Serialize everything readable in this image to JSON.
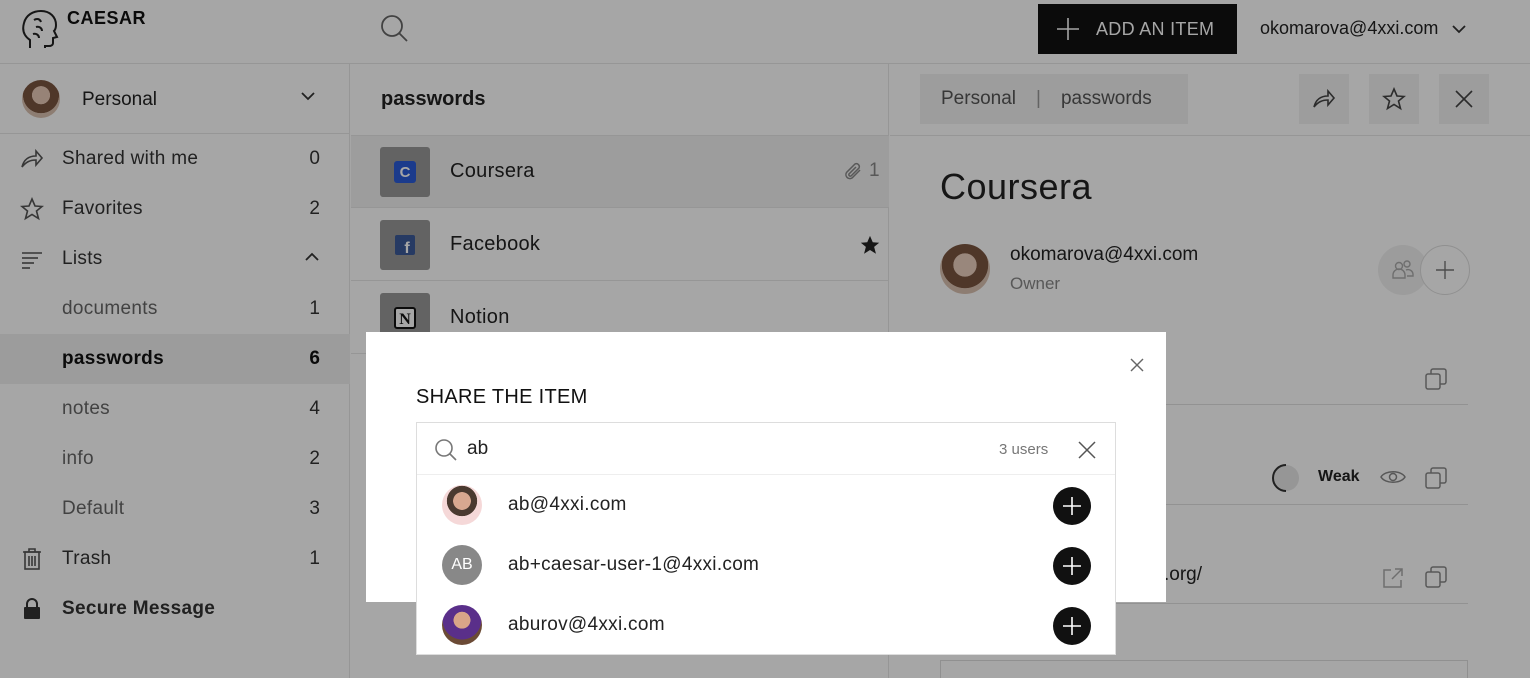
{
  "app": {
    "brand": "CAESAR"
  },
  "header": {
    "add_label": "ADD AN ITEM",
    "user_email": "okomarova@4xxi.com"
  },
  "sidebar": {
    "vault_name": "Personal",
    "items": [
      {
        "label": "Shared with me",
        "count": "0",
        "icon": "share-icon"
      },
      {
        "label": "Favorites",
        "count": "2",
        "icon": "star-icon"
      },
      {
        "label": "Lists",
        "count": "",
        "icon": "lists-icon"
      },
      {
        "label": "documents",
        "count": "1"
      },
      {
        "label": "passwords",
        "count": "6"
      },
      {
        "label": "notes",
        "count": "4"
      },
      {
        "label": "info",
        "count": "2"
      },
      {
        "label": "Default",
        "count": "3"
      },
      {
        "label": "Trash",
        "count": "1",
        "icon": "trash-icon"
      },
      {
        "label": "Secure Message",
        "count": "",
        "icon": "lock-icon"
      }
    ]
  },
  "list": {
    "title": "passwords",
    "items": [
      {
        "name": "Coursera",
        "attachments": "1",
        "icon_letter": "C"
      },
      {
        "name": "Facebook",
        "icon_letter": "f"
      },
      {
        "name": "Notion",
        "icon_letter": "N"
      }
    ]
  },
  "detail": {
    "breadcrumb": {
      "vault": "Personal",
      "separator": "|",
      "list": "passwords"
    },
    "title": "Coursera",
    "owner": {
      "email": "okomarova@4xxi.com",
      "role": "Owner"
    },
    "password_strength": "Weak",
    "url_fragment": ".org/"
  },
  "modal": {
    "title": "SHARE THE ITEM",
    "search_value": "ab",
    "result_count": "3 users",
    "users": [
      {
        "email": "ab@4xxi.com",
        "initials": ""
      },
      {
        "email": "ab+caesar-user-1@4xxi.com",
        "initials": "AB"
      },
      {
        "email": "aburov@4xxi.com",
        "initials": ""
      }
    ]
  },
  "colors": {
    "primary": "#111111",
    "overlay": "rgba(0,0,0,0.35)",
    "selected_bg": "#f0f0f0"
  }
}
